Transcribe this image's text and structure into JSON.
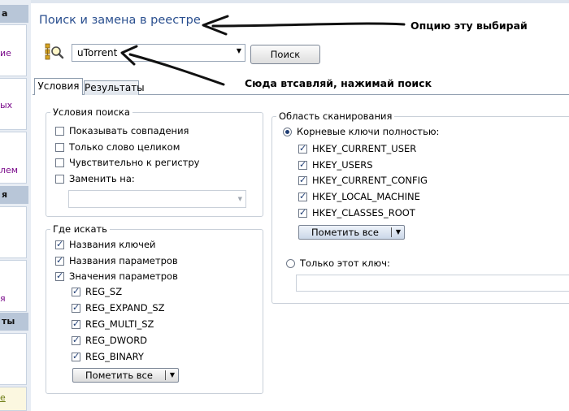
{
  "left_panel": {
    "head1": "а",
    "text1": "ие",
    "text2": "ых",
    "text3": "лем",
    "head2": "я",
    "text4": "я",
    "head3": "ты",
    "text5": "е"
  },
  "title": "Поиск и замена в реестре",
  "search": {
    "value": "uTorrent",
    "button_label": "Поиск"
  },
  "annotations": {
    "choose_option": "Опцию эту выбирай",
    "paste_here": "Сюда втсавляй, нажимай поиск"
  },
  "tabs": [
    {
      "label": "Условия",
      "active": true
    },
    {
      "label": "Результаты",
      "active": false
    }
  ],
  "search_conditions": {
    "title": "Условия поиска",
    "options": [
      {
        "label": "Показывать совпадения",
        "checked": false
      },
      {
        "label": "Только слово целиком",
        "checked": false
      },
      {
        "label": "Чувствительно к регистру",
        "checked": false
      },
      {
        "label": "Заменить на:",
        "checked": false
      }
    ]
  },
  "where_to_search": {
    "title": "Где искать",
    "options": [
      {
        "label": "Названия ключей",
        "checked": true
      },
      {
        "label": "Названия параметров",
        "checked": true
      },
      {
        "label": "Значения параметров",
        "checked": true
      }
    ],
    "types": [
      {
        "label": "REG_SZ",
        "checked": true
      },
      {
        "label": "REG_EXPAND_SZ",
        "checked": true
      },
      {
        "label": "REG_MULTI_SZ",
        "checked": true
      },
      {
        "label": "REG_DWORD",
        "checked": true
      },
      {
        "label": "REG_BINARY",
        "checked": true
      }
    ],
    "mark_all_label": "Пометить все"
  },
  "scan_area": {
    "title": "Область сканирования",
    "root_keys_label": "Корневые ключи полностью:",
    "root_keys_selected": true,
    "keys": [
      {
        "label": "HKEY_CURRENT_USER",
        "checked": true
      },
      {
        "label": "HKEY_USERS",
        "checked": true
      },
      {
        "label": "HKEY_CURRENT_CONFIG",
        "checked": true
      },
      {
        "label": "HKEY_LOCAL_MACHINE",
        "checked": true
      },
      {
        "label": "HKEY_CLASSES_ROOT",
        "checked": true
      }
    ],
    "mark_all_label": "Пометить все",
    "only_key_label": "Только этот ключ:",
    "only_key_selected": false
  }
}
